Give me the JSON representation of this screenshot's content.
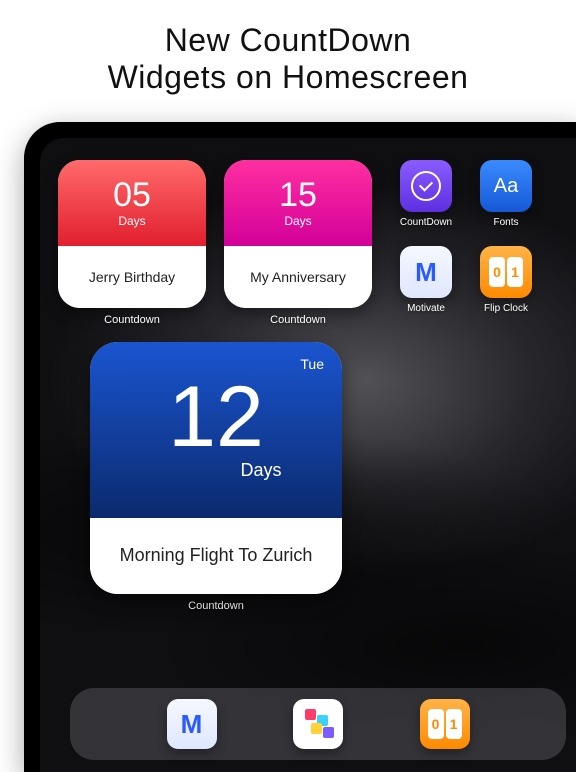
{
  "promo": {
    "heading_line1": "New CountDown",
    "heading_line2": "Widgets on Homescreen"
  },
  "widgets": {
    "small": [
      {
        "count": "05",
        "unit": "Days",
        "title": "Jerry  Birthday",
        "label": "Countdown",
        "gradient": "red"
      },
      {
        "count": "15",
        "unit": "Days",
        "title": "My Anniversary",
        "label": "Countdown",
        "gradient": "pink"
      }
    ],
    "large": {
      "weekday": "Tue",
      "count": "12",
      "unit": "Days",
      "title": "Morning Flight To Zurich",
      "label": "Countdown"
    }
  },
  "apps": [
    {
      "name": "CountDown",
      "icon": "countdown-icon"
    },
    {
      "name": "Fonts",
      "icon": "fonts-icon",
      "glyph": "Aa"
    },
    {
      "name": "Motivate",
      "icon": "motivate-icon",
      "glyph": "M"
    },
    {
      "name": "Flip Clock",
      "icon": "flip-clock-icon"
    }
  ],
  "dock": [
    {
      "icon": "motivate-icon",
      "glyph": "M"
    },
    {
      "icon": "blocks-icon"
    },
    {
      "icon": "flip-clock-icon"
    }
  ],
  "flip_digits": {
    "d1": "0",
    "d2": "1"
  }
}
